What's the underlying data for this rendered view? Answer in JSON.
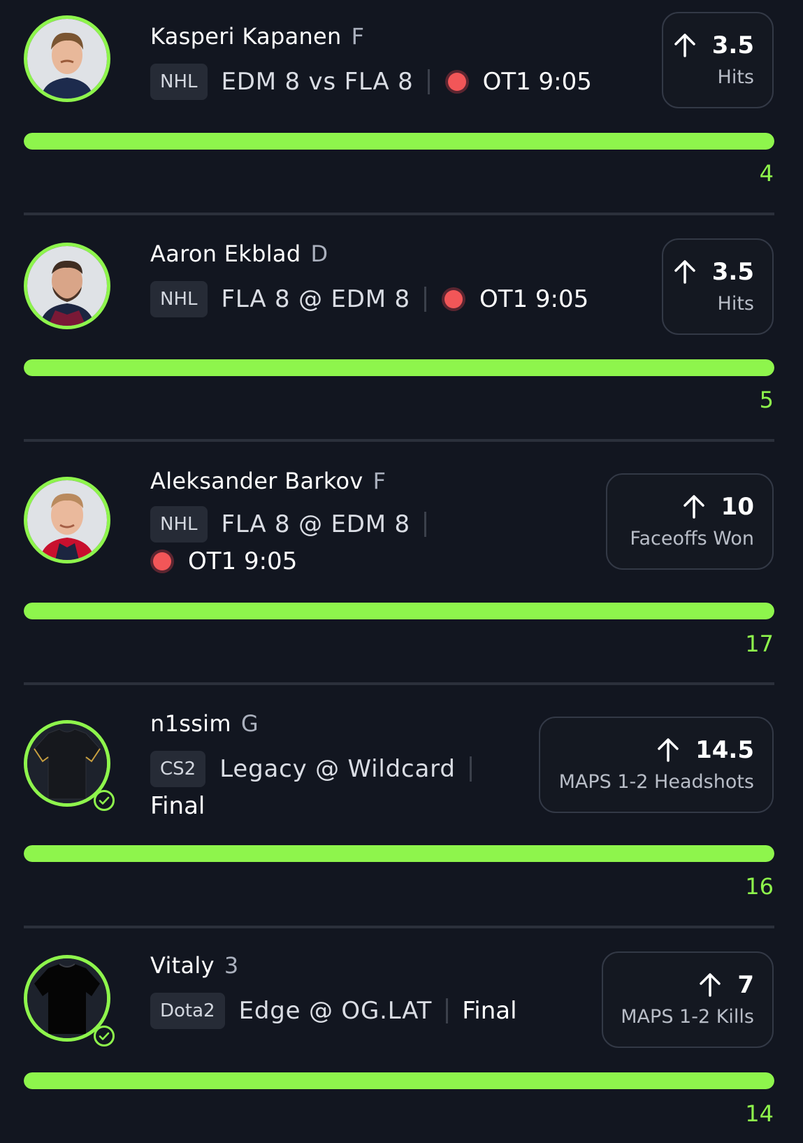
{
  "accent_color": "#8ef54c",
  "live_color": "#f25658",
  "picks": [
    {
      "player": "Kasperi Kapanen",
      "position": "F",
      "league": "NHL",
      "matchup": "EDM 8 vs FLA 8",
      "live": true,
      "status": "OT1 9:05",
      "direction": "up-arrow-icon",
      "line": "3.5",
      "stat": "Hits",
      "actual": "4",
      "progress_fraction": 1.0
    },
    {
      "player": "Aaron Ekblad",
      "position": "D",
      "league": "NHL",
      "matchup": "FLA 8 @ EDM 8",
      "live": true,
      "status": "OT1 9:05",
      "direction": "up-arrow-icon",
      "line": "3.5",
      "stat": "Hits",
      "actual": "5",
      "progress_fraction": 1.0
    },
    {
      "player": "Aleksander Barkov",
      "position": "F",
      "league": "NHL",
      "matchup": "FLA 8 @ EDM 8",
      "live": true,
      "status": "OT1 9:05",
      "direction": "up-arrow-icon",
      "line": "10",
      "stat": "Faceoffs Won",
      "actual": "17",
      "progress_fraction": 1.0
    },
    {
      "player": "n1ssim",
      "position": "G",
      "league": "CS2",
      "matchup": "Legacy @ Wildcard",
      "live": false,
      "status": "Final",
      "direction": "up-arrow-icon",
      "line": "14.5",
      "stat": "MAPS 1-2 Headshots",
      "actual": "16",
      "progress_fraction": 1.0
    },
    {
      "player": "Vitaly",
      "position": "3",
      "league": "Dota2",
      "matchup": "Edge @ OG.LAT",
      "live": false,
      "status": "Final",
      "direction": "up-arrow-icon",
      "line": "7",
      "stat": "MAPS 1-2 Kills",
      "actual": "14",
      "progress_fraction": 1.0
    }
  ]
}
